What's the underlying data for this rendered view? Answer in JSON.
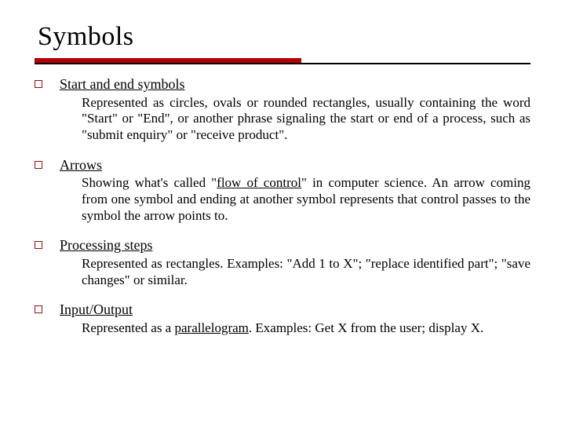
{
  "title": "Symbols",
  "items": [
    {
      "term": "Start and end symbols",
      "desc_parts": [
        {
          "text": "Represented as circles, ovals or rounded rectangles, usually containing the word \"Start\" or \"End\", or another phrase signaling the start or end of a process, such as \"submit enquiry\" or \"receive product\".",
          "link": false
        }
      ]
    },
    {
      "term": "Arrows",
      "desc_parts": [
        {
          "text": "Showing what's called \"",
          "link": false
        },
        {
          "text": "flow of control",
          "link": true
        },
        {
          "text": "\" in computer science. An arrow coming from one symbol and ending at another symbol represents that control passes to the symbol the arrow points to.",
          "link": false
        }
      ]
    },
    {
      "term": "Processing steps",
      "desc_parts": [
        {
          "text": "Represented as rectangles. Examples: \"Add 1 to X\"; \"replace identified part\"; \"save changes\" or similar.",
          "link": false
        }
      ]
    },
    {
      "term": "Input/Output",
      "desc_parts": [
        {
          "text": "Represented as a ",
          "link": false
        },
        {
          "text": "parallelogram",
          "link": true
        },
        {
          "text": ". Examples: Get X from the user; display X.",
          "link": false
        }
      ]
    }
  ]
}
